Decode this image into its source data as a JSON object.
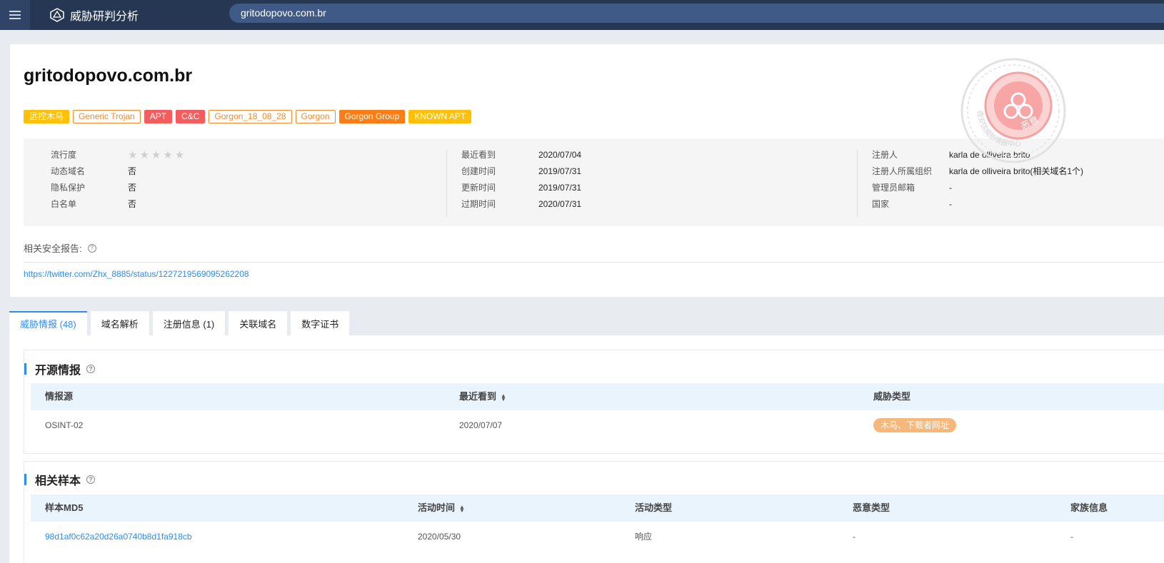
{
  "app": {
    "title": "威胁研判分析",
    "search_value": "gritodopovo.com.br"
  },
  "domain": {
    "name": "gritodopovo.com.br",
    "tags": [
      {
        "label": "远控木马",
        "style": "yellow"
      },
      {
        "label": "Generic Trojan",
        "style": "outline"
      },
      {
        "label": "APT",
        "style": "red"
      },
      {
        "label": "C&C",
        "style": "red"
      },
      {
        "label": "Gorgon_18_08_28",
        "style": "outline"
      },
      {
        "label": "Gorgon",
        "style": "outline"
      },
      {
        "label": "Gorgon Group",
        "style": "orange"
      },
      {
        "label": "KNOWN APT",
        "style": "yellow"
      }
    ]
  },
  "info": {
    "col1": [
      {
        "k": "流行度",
        "v": "",
        "stars": 0
      },
      {
        "k": "动态域名",
        "v": "否"
      },
      {
        "k": "隐私保护",
        "v": "否"
      },
      {
        "k": "白名单",
        "v": "否"
      }
    ],
    "col2": [
      {
        "k": "最近看到",
        "v": "2020/07/04"
      },
      {
        "k": "创建时间",
        "v": "2019/07/31"
      },
      {
        "k": "更新时间",
        "v": "2019/07/31"
      },
      {
        "k": "过期时间",
        "v": "2020/07/31"
      }
    ],
    "col3": [
      {
        "k": "注册人",
        "v": "karla de olliveira brito"
      },
      {
        "k": "注册人所属组织",
        "v": "karla de olliveira brito",
        "extra": " (相关域名1个)"
      },
      {
        "k": "管理员邮箱",
        "v": "-"
      },
      {
        "k": "国家",
        "v": "-"
      }
    ]
  },
  "stamp": {
    "text": "奇安信威胁情报中心",
    "label": "恶意"
  },
  "report": {
    "label": "相关安全报告:",
    "link": "https://twitter.com/Zhx_8885/status/1227219569095262208"
  },
  "tabs": [
    "威胁情报 (48)",
    "域名解析",
    "注册信息 (1)",
    "关联域名",
    "数字证书"
  ],
  "osint": {
    "title": "开源情报",
    "headers": [
      "情报源",
      "最近看到",
      "威胁类型"
    ],
    "rows": [
      {
        "source": "OSINT-02",
        "seen": "2020/07/07",
        "type": "木马、下载者网址"
      }
    ]
  },
  "samples": {
    "title": "相关样本",
    "headers": [
      "样本MD5",
      "活动时间",
      "活动类型",
      "恶意类型",
      "家族信息"
    ],
    "rows": [
      {
        "md5": "98d1af0c62a20d26a0740b8d1fa918cb",
        "time": "2020/05/30",
        "activity": "响应",
        "malware": "-",
        "family": "-"
      }
    ]
  },
  "colors": {
    "accent": "#2d8cf0",
    "topbar": "#263754",
    "search": "#405a87"
  }
}
